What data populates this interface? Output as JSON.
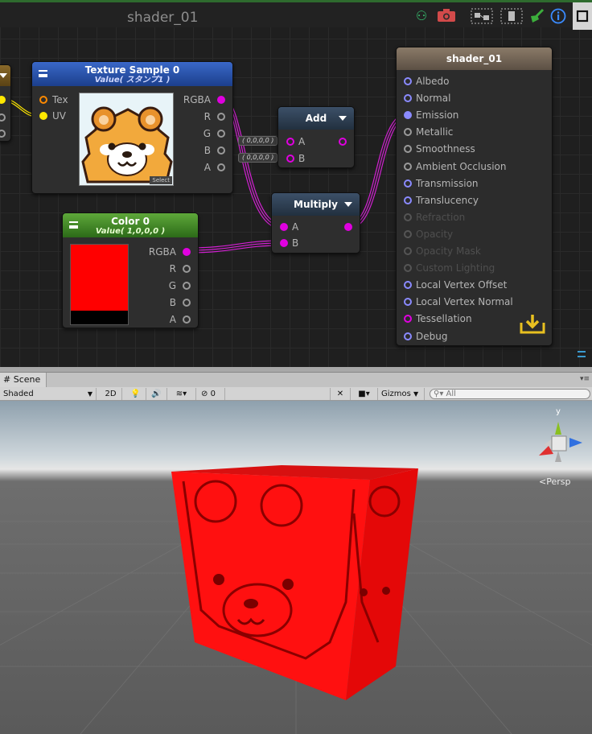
{
  "editor": {
    "title": "shader_01",
    "toolbar_icons": [
      "share-icon",
      "camera-icon",
      "node-view-icon",
      "doc-icon",
      "broom-icon",
      "info-icon",
      "maximize-icon"
    ]
  },
  "texture_node": {
    "title": "Texture Sample 0",
    "subtitle": "Value( スタンプ1 )",
    "inputs": [
      "Tex",
      "UV"
    ],
    "outputs": [
      "RGBA",
      "R",
      "G",
      "B",
      "A"
    ],
    "select_label": "Select"
  },
  "color_node": {
    "title": "Color 0",
    "subtitle": "Value( 1,0,0,0 )",
    "outputs": [
      "RGBA",
      "R",
      "G",
      "B",
      "A"
    ],
    "color": "#ff0000"
  },
  "add_node": {
    "title": "Add",
    "inputs": [
      "A",
      "B"
    ],
    "defaults": [
      "( 0,0,0,0 )",
      "( 0,0,0,0 )"
    ]
  },
  "multiply_node": {
    "title": "Multiply",
    "inputs": [
      "A",
      "B"
    ]
  },
  "output_node": {
    "title": "shader_01",
    "ports": [
      "Albedo",
      "Normal",
      "Emission",
      "Metallic",
      "Smoothness",
      "Ambient Occlusion",
      "Transmission",
      "Translucency",
      "Refraction",
      "Opacity",
      "Opacity Mask",
      "Custom Lighting",
      "Local Vertex Offset",
      "Local Vertex Normal",
      "Tessellation",
      "Debug"
    ]
  },
  "scene": {
    "tab_label": "Scene",
    "shading_mode": "Shaded",
    "mode_2d": "2D",
    "hidden_count": "0",
    "gizmos_label": "Gizmos",
    "search_placeholder": "All",
    "persp_label": "Persp",
    "axis_label": "y",
    "accent_colors": {
      "x": "#e03030",
      "y": "#8ac020",
      "z": "#3070e0"
    }
  }
}
